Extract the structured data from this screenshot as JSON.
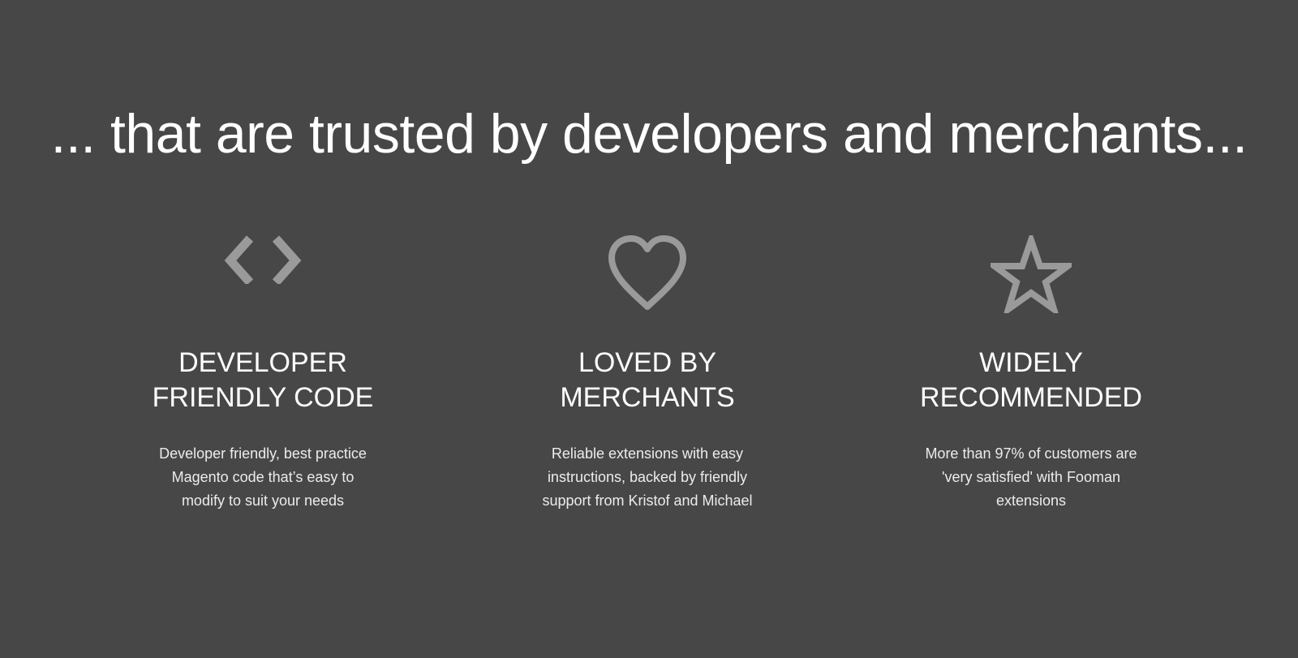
{
  "headline": "... that are trusted by developers and merchants...",
  "colors": {
    "background": "#474747",
    "text": "#ffffff",
    "icon": "#9a9a9a"
  },
  "features": [
    {
      "icon": "code-brackets-icon",
      "title_line1": "DEVELOPER",
      "title_line2": "FRIENDLY CODE",
      "text_line1": "Developer friendly, best practice",
      "text_line2": "Magento code that’s easy to",
      "text_line3": "modify to suit your needs"
    },
    {
      "icon": "heart-icon",
      "title_line1": "LOVED BY",
      "title_line2": "MERCHANTS",
      "text_line1": "Reliable extensions with easy",
      "text_line2": "instructions, backed by friendly",
      "text_line3": "support from Kristof and Michael"
    },
    {
      "icon": "star-icon",
      "title_line1": "WIDELY",
      "title_line2": "RECOMMENDED",
      "text_line1": "More than 97% of customers are",
      "text_line2": "'very satisfied' with Fooman",
      "text_line3": "extensions"
    }
  ]
}
